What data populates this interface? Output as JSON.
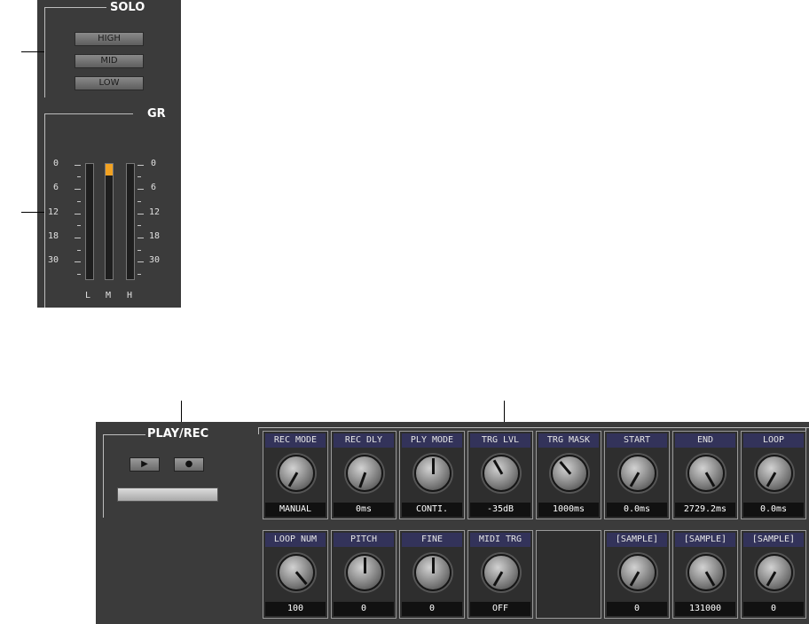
{
  "solo": {
    "title": "SOLO",
    "buttons": [
      "HIGH",
      "MID",
      "LOW"
    ]
  },
  "gr": {
    "title": "GR",
    "scale_left": [
      "0",
      "6",
      "12",
      "18",
      "30"
    ],
    "scale_right": [
      "0",
      "6",
      "12",
      "18",
      "30"
    ],
    "meters": [
      {
        "label": "L",
        "level": 0
      },
      {
        "label": "M",
        "level": 0.1
      },
      {
        "label": "H",
        "level": 0
      }
    ],
    "meter_color": "#f2a222"
  },
  "play_rec": {
    "title": "PLAY/REC",
    "play_symbol": "▶",
    "rec_symbol": "●"
  },
  "params_row1": [
    {
      "label": "REC MODE",
      "value": "MANUAL",
      "angle": -150
    },
    {
      "label": "REC DLY",
      "value": "0ms",
      "angle": -160
    },
    {
      "label": "PLY MODE",
      "value": "CONTI.",
      "angle": 0
    },
    {
      "label": "TRG LVL",
      "value": "-35dB",
      "angle": -30
    },
    {
      "label": "TRG MASK",
      "value": "1000ms",
      "angle": -40
    },
    {
      "label": "START",
      "value": "0.0ms",
      "angle": -150
    },
    {
      "label": "END",
      "value": "2729.2ms",
      "angle": 150
    },
    {
      "label": "LOOP",
      "value": "0.0ms",
      "angle": -150
    }
  ],
  "params_row2": [
    {
      "label": "LOOP NUM",
      "value": "100",
      "angle": 140
    },
    {
      "label": "PITCH",
      "value": "0",
      "angle": 0
    },
    {
      "label": "FINE",
      "value": "0",
      "angle": 0
    },
    {
      "label": "MIDI TRG",
      "value": "OFF",
      "angle": -150
    },
    {
      "label": "",
      "value": "",
      "empty": true
    },
    {
      "label": "[SAMPLE]",
      "value": "0",
      "angle": -150
    },
    {
      "label": "[SAMPLE]",
      "value": "131000",
      "angle": 150
    },
    {
      "label": "[SAMPLE]",
      "value": "0",
      "angle": -150
    }
  ]
}
